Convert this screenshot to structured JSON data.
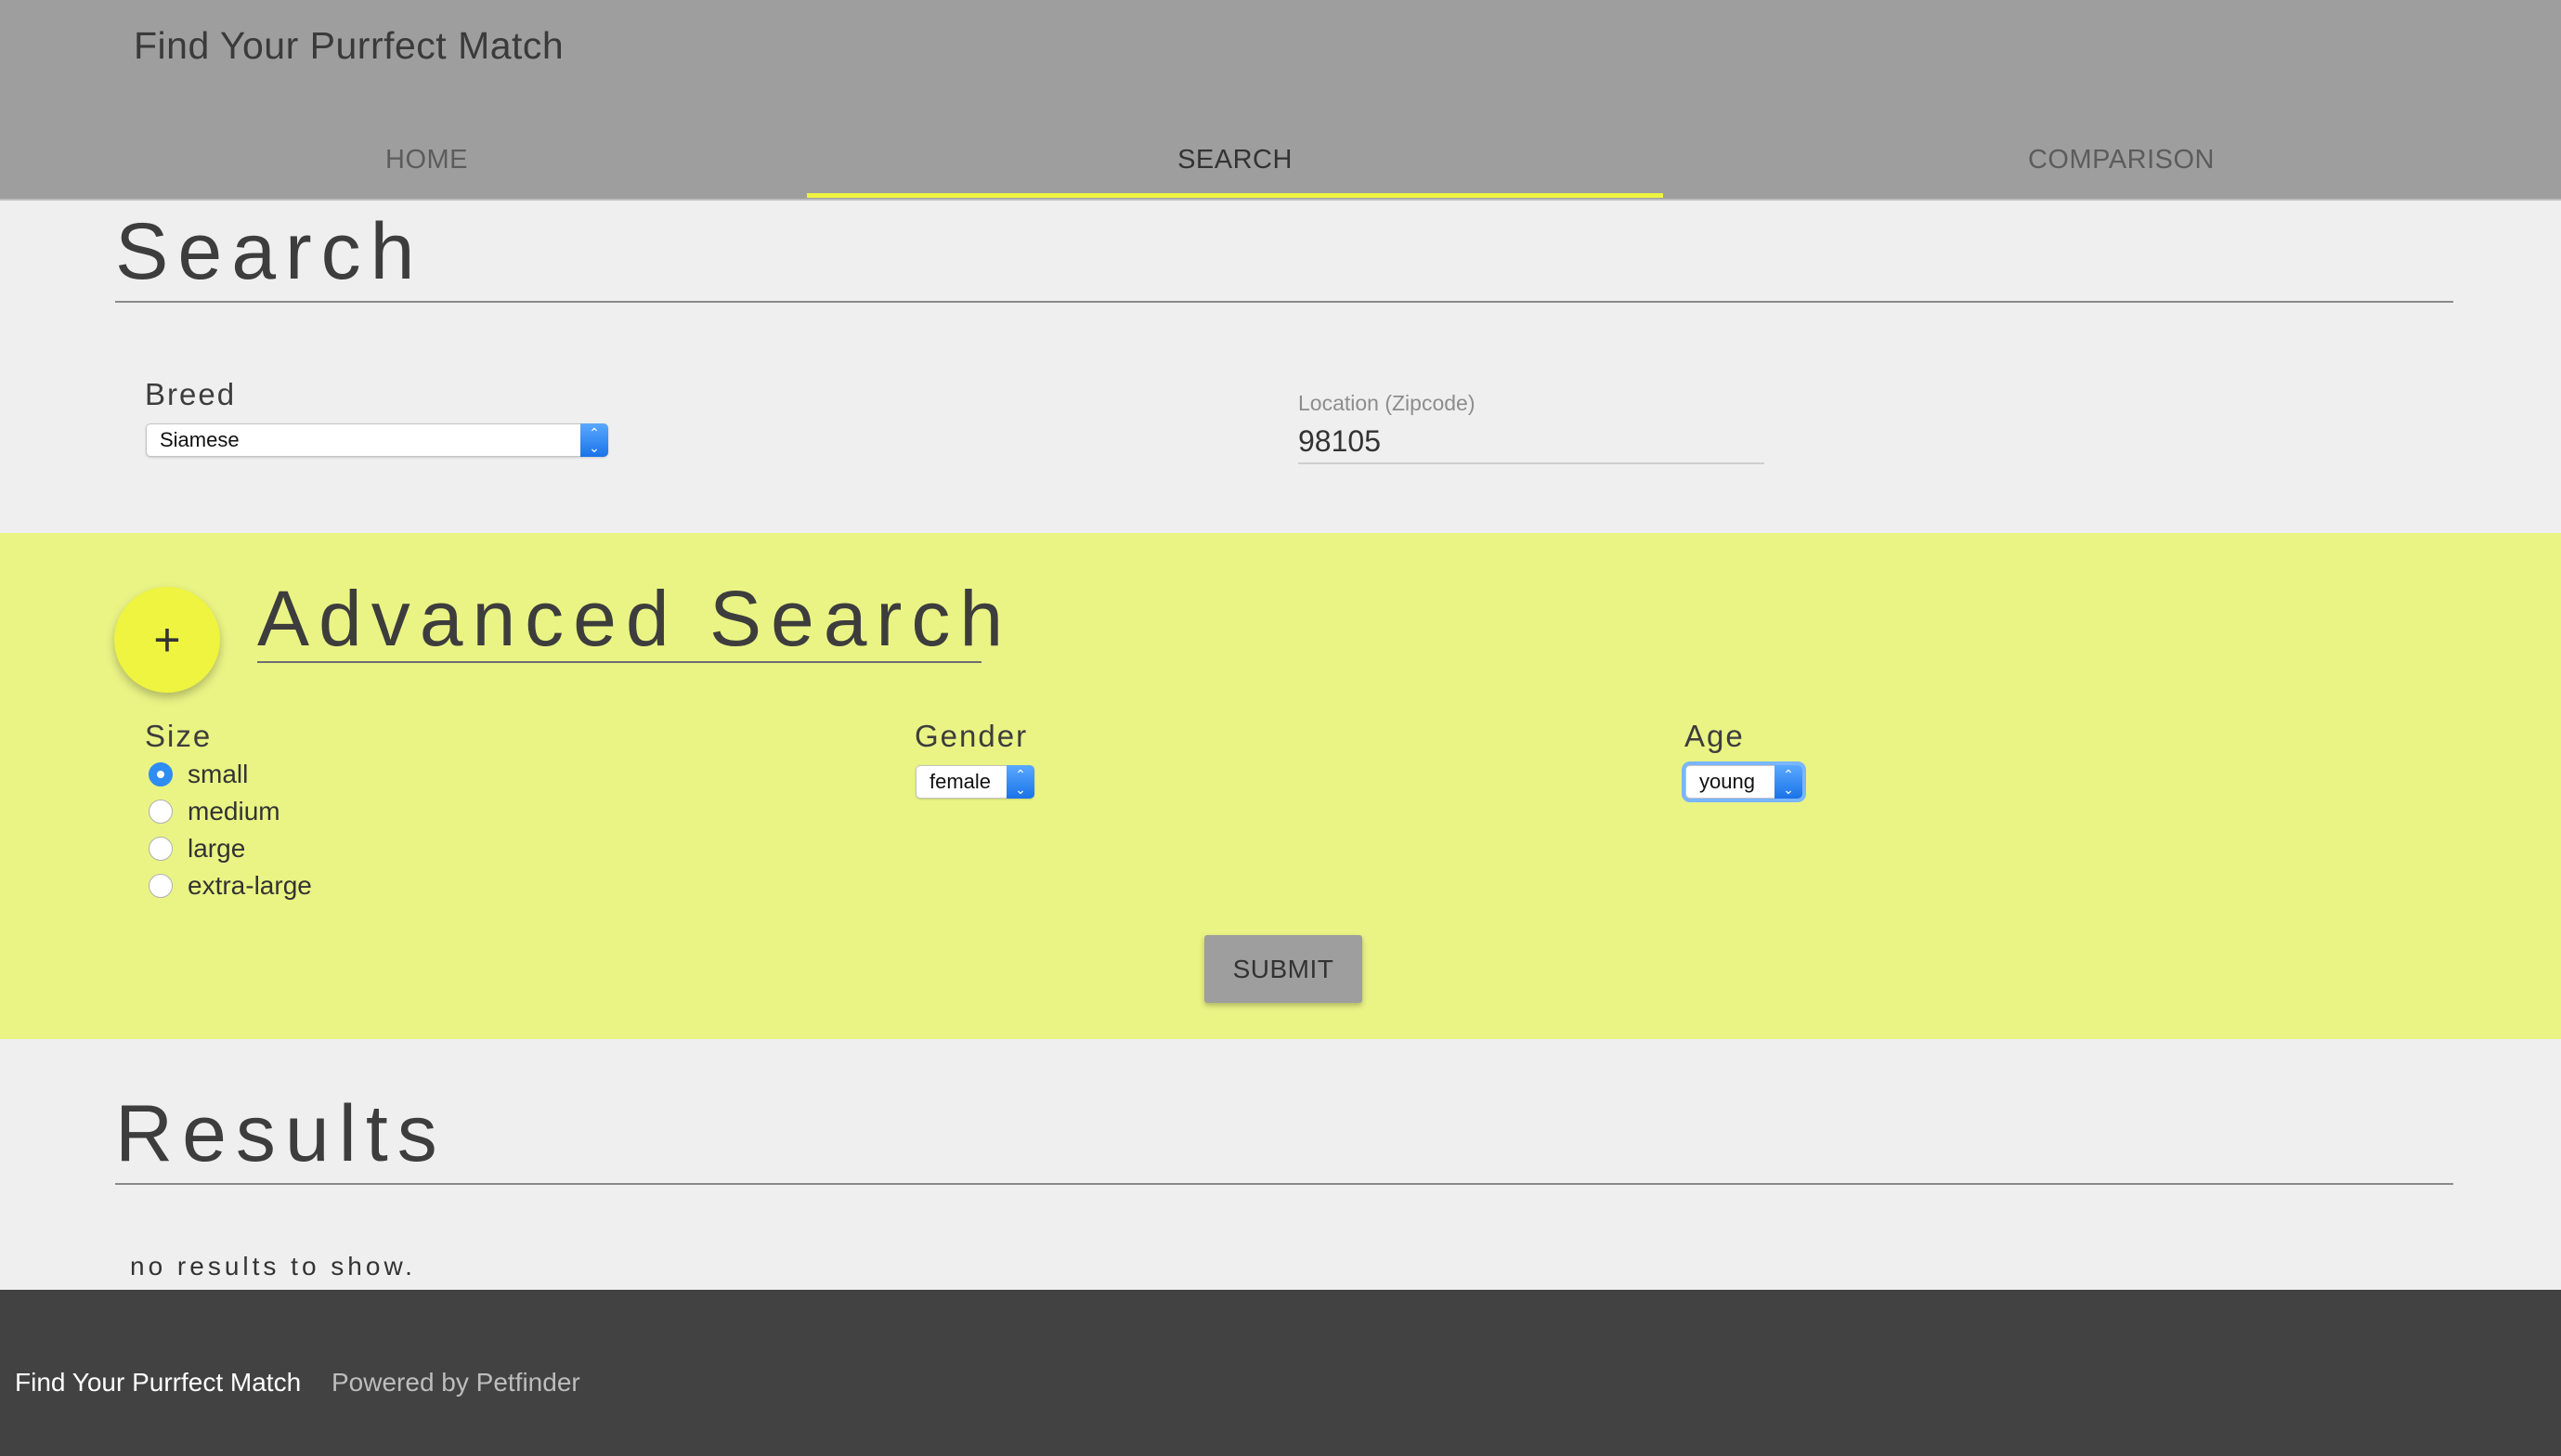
{
  "header": {
    "title": "Find Your Purrfect Match",
    "tabs": [
      {
        "label": "HOME"
      },
      {
        "label": "SEARCH"
      },
      {
        "label": "COMPARISON"
      }
    ],
    "active_tab": "SEARCH",
    "indicator_color": "#eef43f"
  },
  "search": {
    "title": "Search",
    "breed": {
      "label": "Breed",
      "value": "Siamese"
    },
    "location": {
      "label": "Location (Zipcode)",
      "value": "98105"
    }
  },
  "advanced": {
    "title": "Advanced Search",
    "toggle_icon": "+",
    "background": "#eaf485",
    "size": {
      "label": "Size",
      "options": [
        "small",
        "medium",
        "large",
        "extra-large"
      ],
      "selected": "small"
    },
    "gender": {
      "label": "Gender",
      "value": "female"
    },
    "age": {
      "label": "Age",
      "value": "young"
    },
    "submit_label": "SUBMIT"
  },
  "results": {
    "title": "Results",
    "empty_message": "no results to show."
  },
  "footer": {
    "brand": "Find Your Purrfect Match",
    "powered_by": "Powered by Petfinder"
  }
}
